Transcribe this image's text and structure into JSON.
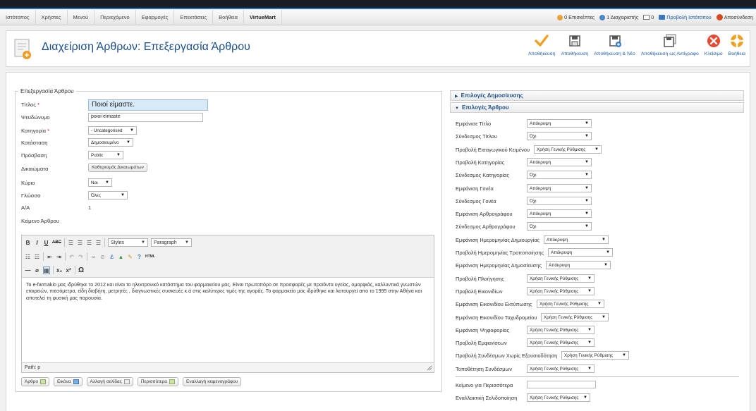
{
  "menu": [
    "Ιστότοπος",
    "Χρήστες",
    "Μενού",
    "Περιεχόμενο",
    "Εφαρμογές",
    "Επεκτάσεις",
    "Βοήθεια",
    "VirtueMart"
  ],
  "status": {
    "visitors": "0 Επισκέπτες",
    "admins": "1 Διαχειριστής",
    "messages": "0",
    "view_site": "Προβολή Ιστότοπου",
    "logout": "Αποσύνδεση"
  },
  "header": {
    "title": "Διαχείριση Άρθρων: Επεξεργασία Άρθρου"
  },
  "toolbar": {
    "save": "Αποθήκευση",
    "save_close": "Αποθήκευση",
    "save_new": "Αποθήκευση & Νέο",
    "save_copy": "Αποθήκευση ως Αντίγραφο",
    "close": "Κλείσιμο",
    "help": "Βοήθεια"
  },
  "form": {
    "legend": "Επεξεργασία Άρθρου",
    "title_label": "Τίτλος",
    "title_value": "Ποιοί είμαστε.",
    "alias_label": "Ψευδώνυμο",
    "alias_value": "poioi-eimaste",
    "category_label": "Κατηγορία",
    "category_value": "- Uncategorised",
    "state_label": "Κατάσταση",
    "state_value": "Δημοσιευμένο",
    "access_label": "Πρόσβαση",
    "access_value": "Public",
    "permissions_label": "Δικαιώματα",
    "permissions_button": "Καθορισμός Δικαιωμάτων",
    "featured_label": "Κύριο",
    "featured_value": "Ναι",
    "language_label": "Γλώσσα",
    "language_value": "Όλες",
    "id_label": "Α/Α",
    "id_value": "1",
    "text_label": "Κείμενο Άρθρου"
  },
  "editor": {
    "styles": "Styles",
    "paragraph": "Paragraph",
    "html_label": "HTML",
    "body": "Το e-farmakio μας ιδρύθηκε το 2012 και είναι το ηλεκτρονικό κατάστημα του φαρμακείου μας. Είναι πρωτοπόρο σε προσφορές με προϊόντα υγείας, ομορφιάς, καλλυντικά γνωστών εταιρειών, πιεσόμετρα, είδη διαβήτη, μετρητές , διαγνωστικές συσκευές κ.ά στις καλύτερες τιμές της αγοράς. Το φαρμακείο μας ιδρύθηκε και λειτουργεί απο το 1995 στην Αθήνα και αποτελεί τη φυσική μας παρουσία.",
    "path": "Path: p"
  },
  "editor_buttons": [
    "Άρθρο",
    "Εικόνα",
    "Αλλαγή σελίδας",
    "Περισσότερα",
    "Εναλλαγή κειμενογράφου"
  ],
  "panels": {
    "publishing": "Επιλογές Δημοσίευσης",
    "article": "Επιλογές Άρθρου"
  },
  "options": [
    {
      "label": "Εμφάνισε Τίτλο",
      "value": "Απόκρυψη"
    },
    {
      "label": "Σύνδεσμος Τίτλου",
      "value": "Όχι"
    },
    {
      "label": "Προβολή Εισαγωγικού Κειμένου",
      "value": "Χρήση Γενικής Ρύθμισης"
    },
    {
      "label": "Προβολή Κατηγορίας",
      "value": "Απόκρυψη"
    },
    {
      "label": "Σύνδεσμος Κατηγορίας",
      "value": "Όχι"
    },
    {
      "label": "Εμφάνιση Γονέα",
      "value": "Απόκρυψη"
    },
    {
      "label": "Σύνδεσμος Γονέα",
      "value": "Όχι"
    },
    {
      "label": "Εμφάνιση Αρθρογράφου",
      "value": "Απόκρυψη"
    },
    {
      "label": "Σύνδεσμος Αρθρογράφου",
      "value": "Όχι"
    },
    {
      "label": "Εμφάνιση Ημερομηνίας Δημιουργίας",
      "value": "Απόκρυψη"
    },
    {
      "label": "Προβολή Ημερομηνίας Τροποποίησης",
      "value": "Απόκρυψη"
    },
    {
      "label": "Εμφάνιση Ημερομηνίας Δημοσίευσης",
      "value": "Απόκρυψη"
    },
    {
      "label": "Προβολή Πλοήγησης",
      "value": "Χρήση Γενικής Ρύθμισης"
    },
    {
      "label": "Προβολή Εικονιδίων",
      "value": "Χρήση Γενικής Ρύθμισης"
    },
    {
      "label": "Εμφάνιση Εικονιδίου Εκτύπωσης",
      "value": "Χρήση Γενικής Ρύθμισης"
    },
    {
      "label": "Εμφάνιση Εικονιδίου Ταχυδρομείου",
      "value": "Χρήση Γενικής Ρύθμισης"
    },
    {
      "label": "Εμφάνιση Ψηφοφορίας",
      "value": "Χρήση Γενικής Ρύθμισης"
    },
    {
      "label": "Προβολή Εμφανίσεων",
      "value": "Χρήση Γενικής Ρύθμισης"
    },
    {
      "label": "Προβολή Συνδέσμων Χωρίς Εξουσιοδότηση",
      "value": "Χρήση Γενικής Ρύθμισης"
    },
    {
      "label": "Τοποθέτηση Συνδέσμων",
      "value": "Χρήση Γενικής Ρύθμισης"
    }
  ],
  "extra": {
    "readmore_label": "Κείμενο για Περισσότερα",
    "readmore_value": "",
    "alt_layout_label": "Εναλλακτική Σελιδοποίηση",
    "alt_layout_value": "Χρήση Γενικής Ρύθμισης"
  },
  "colors": {
    "accent": "#1c4f8b",
    "link": "#1a5ca8",
    "save": "#f0a020",
    "close": "#e8492f"
  }
}
